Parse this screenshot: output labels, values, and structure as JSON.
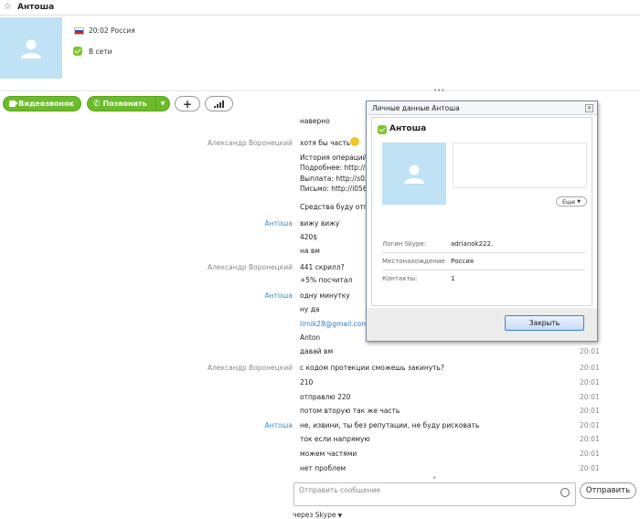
{
  "header": {
    "contact_name": "Антоша",
    "local_time": "20:02 Россия",
    "status": "В сети"
  },
  "toolbar": {
    "video_label": "Видеозвонок",
    "call_label": "Позвонить",
    "add_label": "+"
  },
  "chat": {
    "messages": [
      {
        "sender": "",
        "text": "наверно",
        "time": ""
      },
      {
        "sender": "Александр Воронецкий",
        "text": "хотя бы часть",
        "time": ""
      },
      {
        "sender": "",
        "text": "История операций: h",
        "time": ""
      },
      {
        "sender": "",
        "text": "Подробнее: http://sl",
        "time": ""
      },
      {
        "sender": "",
        "text": "Выплата: http://s020",
        "time": ""
      },
      {
        "sender": "",
        "text": "Письмо: http://i056.r",
        "time": ""
      },
      {
        "sender": "",
        "text": "Средства буду отпра",
        "time": ""
      },
      {
        "sender": "Антоша",
        "text": "вижу вижу",
        "time": ""
      },
      {
        "sender": "",
        "text": "420$",
        "time": ""
      },
      {
        "sender": "",
        "text": "на вм",
        "time": ""
      },
      {
        "sender": "Александр Воронецкий",
        "text": "441 скрилл?",
        "time": ""
      },
      {
        "sender": "",
        "text": "+5% посчитал",
        "time": ""
      },
      {
        "sender": "Антоша",
        "text": "одну минутку",
        "time": ""
      },
      {
        "sender": "",
        "text": "ну да",
        "time": ""
      },
      {
        "sender": "",
        "text": "lirnik28@gmail.com",
        "time": ""
      },
      {
        "sender": "",
        "text": "Anton",
        "time": ""
      },
      {
        "sender": "",
        "text": "давай вм",
        "time": "20:01"
      },
      {
        "sender": "Александр Воронецкий",
        "text": "с кодом протекции сможешь закинуть?",
        "time": "20:01"
      },
      {
        "sender": "",
        "text": "210",
        "time": "20:01"
      },
      {
        "sender": "",
        "text": "отправлю 220",
        "time": "20:01"
      },
      {
        "sender": "",
        "text": "потом вторую так же часть",
        "time": "20:01"
      },
      {
        "sender": "Антоша",
        "text": "не, извини, ты без репутации, не буду рисковать",
        "time": "20:01"
      },
      {
        "sender": "",
        "text": "ток если напрямую",
        "time": "20:01"
      },
      {
        "sender": "",
        "text": "можем частями",
        "time": "20:01"
      },
      {
        "sender": "",
        "text": "нет проблем",
        "time": "20:01"
      }
    ]
  },
  "compose": {
    "placeholder": "Отправить сообщение",
    "send_label": "Отправить",
    "via_label": "через Skype"
  },
  "dialog": {
    "title": "Личные данные Антоша",
    "close_glyph": "×",
    "name": "Антоша",
    "more_label": "Еще",
    "fields": [
      {
        "label": "Логин Skype:",
        "value": "adrianok222."
      },
      {
        "label": "Местонахождение",
        "value": "Россия"
      },
      {
        "label": "Контакты:",
        "value": "1"
      }
    ],
    "close_button_label": "Закрыть"
  },
  "colors": {
    "accent_green": "#6cbb2a",
    "link_blue": "#2a7ec3",
    "avatar_bg": "#bfe2f5"
  }
}
